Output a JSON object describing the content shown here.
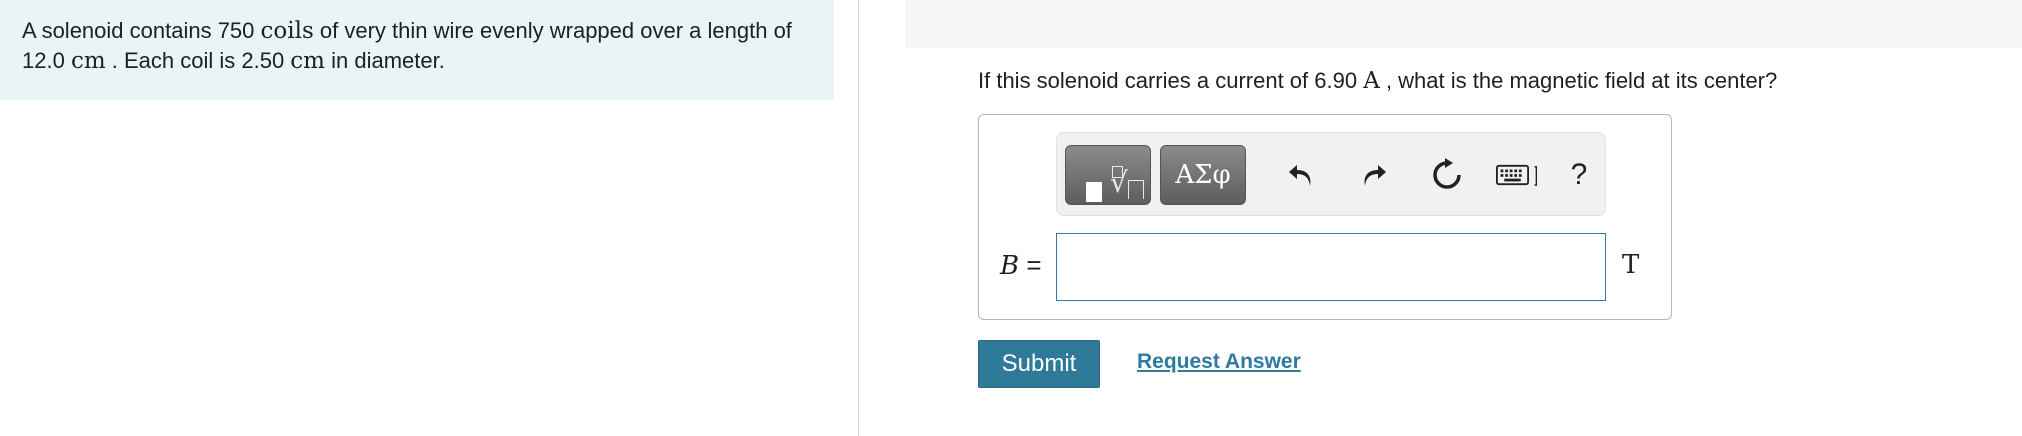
{
  "problem": {
    "part1": "A solenoid contains 750 ",
    "coils": "coils",
    "part2": " of very thin wire evenly wrapped over a length of 12.0 ",
    "cm1": "cm",
    "part3": " . Each coil is 2.50 ",
    "cm2": "cm",
    "part4": " in diameter."
  },
  "question": {
    "part1": "If this solenoid carries a current of 6.90 ",
    "unit": "A",
    "part2": " , what is the magnetic field at its center?"
  },
  "toolbar": {
    "symbols_label": "ΑΣφ",
    "help_label": "?",
    "icons": [
      "templates-icon",
      "symbols-icon",
      "undo-icon",
      "redo-icon",
      "reset-icon",
      "keyboard-icon",
      "help-icon"
    ]
  },
  "answer": {
    "variable": "B",
    "equals": " =",
    "value": "",
    "unit": "T"
  },
  "actions": {
    "submit_label": "Submit",
    "request_label": "Request Answer"
  },
  "colors": {
    "problem_bg": "#e8f4f6",
    "submit_bg": "#2f7a99",
    "link": "#2f7aa0",
    "input_border": "#2f7ea2"
  }
}
